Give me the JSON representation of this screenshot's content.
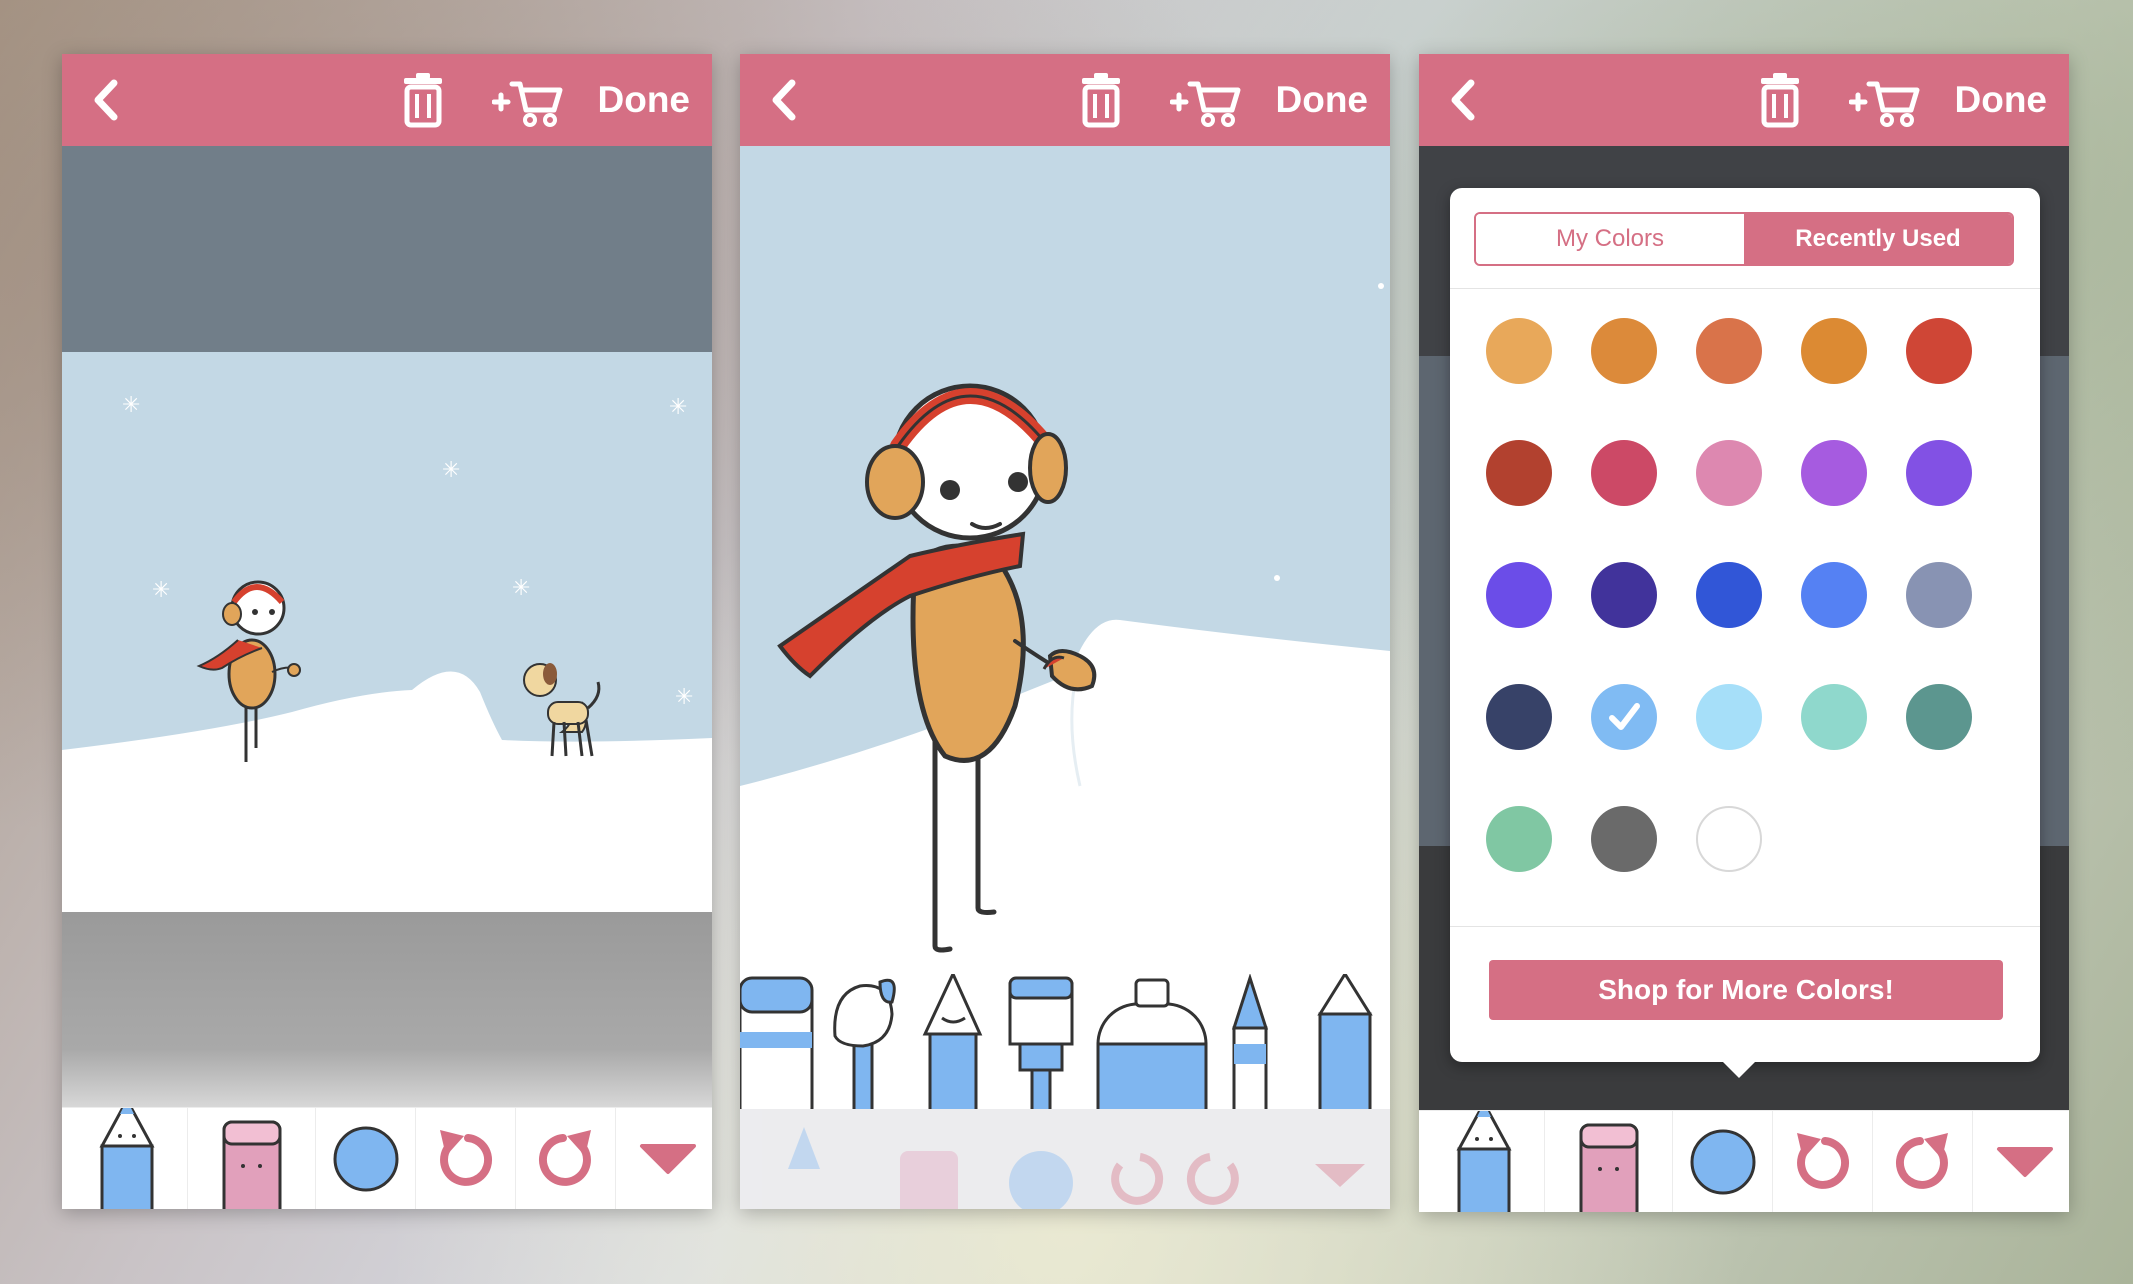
{
  "topbar": {
    "done_label": "Done",
    "icons": [
      "back-icon",
      "trash-icon",
      "add-to-cart-icon"
    ],
    "color": "#d56f84"
  },
  "toolbar": {
    "items": [
      "pencil-tool",
      "eraser-tool",
      "color-picker",
      "undo-icon",
      "redo-icon",
      "dropdown-triangle-icon"
    ],
    "accent": "#7fb6f0"
  },
  "tool_tray": {
    "tools": [
      "marker",
      "round-brush",
      "fountain-pen",
      "flat-brush",
      "spray-can",
      "crayon",
      "pencil"
    ]
  },
  "color_picker": {
    "tabs": [
      {
        "label": "My Colors",
        "selected": false
      },
      {
        "label": "Recently Used",
        "selected": true
      }
    ],
    "colors": [
      "#e8a85a",
      "#dc8a3a",
      "#d9734a",
      "#dc8a33",
      "#cf4636",
      "#b2412f",
      "#cc4966",
      "#dd88b0",
      "#a65be0",
      "#8251e4",
      "#6b4de8",
      "#41339b",
      "#3156d7",
      "#5581f3",
      "#8893b3",
      "#374268",
      "#80bbf3",
      "#a6dff9",
      "#8fd8cc",
      "#5c968f",
      "#80c7a3",
      "#6a6a6a",
      "#ffffff"
    ],
    "selected_color": "#80bbf3",
    "shop_button_label": "Shop for More Colors!"
  }
}
